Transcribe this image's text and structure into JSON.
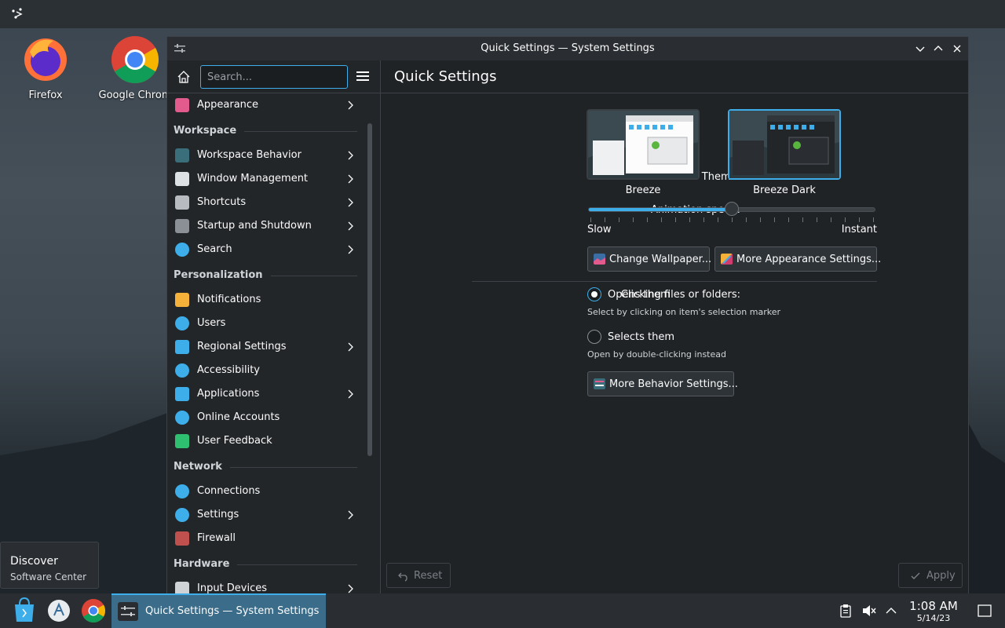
{
  "desktop": {
    "icons": [
      {
        "label": "Firefox",
        "icon": "firefox-icon"
      },
      {
        "label": "Google Chrom",
        "icon": "chrome-icon"
      }
    ]
  },
  "window": {
    "title": "Quick Settings — System Settings",
    "search_placeholder": "Search...",
    "sidebar": {
      "items": [
        {
          "label": "Appearance",
          "icon": "appearance-icon",
          "chevron": true
        },
        {
          "section": "Workspace"
        },
        {
          "label": "Workspace Behavior",
          "icon": "workspace-behavior-icon",
          "chevron": true
        },
        {
          "label": "Window Management",
          "icon": "window-management-icon",
          "chevron": true
        },
        {
          "label": "Shortcuts",
          "icon": "keyboard-icon",
          "chevron": true
        },
        {
          "label": "Startup and Shutdown",
          "icon": "startup-icon",
          "chevron": true
        },
        {
          "label": "Search",
          "icon": "search-icon",
          "chevron": true
        },
        {
          "section": "Personalization"
        },
        {
          "label": "Notifications",
          "icon": "bell-icon",
          "chevron": false
        },
        {
          "label": "Users",
          "icon": "users-icon",
          "chevron": false
        },
        {
          "label": "Regional Settings",
          "icon": "regional-icon",
          "chevron": true
        },
        {
          "label": "Accessibility",
          "icon": "accessibility-icon",
          "chevron": false
        },
        {
          "label": "Applications",
          "icon": "applications-icon",
          "chevron": true
        },
        {
          "label": "Online Accounts",
          "icon": "online-accounts-icon",
          "chevron": false
        },
        {
          "label": "User Feedback",
          "icon": "feedback-icon",
          "chevron": false
        },
        {
          "section": "Network"
        },
        {
          "label": "Connections",
          "icon": "globe-icon",
          "chevron": false
        },
        {
          "label": "Settings",
          "icon": "globe-icon",
          "chevron": true
        },
        {
          "label": "Firewall",
          "icon": "firewall-icon",
          "chevron": false
        },
        {
          "section": "Hardware"
        },
        {
          "label": "Input Devices",
          "icon": "mouse-icon",
          "chevron": true
        }
      ]
    },
    "main": {
      "heading": "Quick Settings",
      "theme_label": "Theme:",
      "themes": [
        {
          "name": "Breeze",
          "selected": false
        },
        {
          "name": "Breeze Dark",
          "selected": true
        }
      ],
      "animation_label": "Animation speed:",
      "animation_value": 0.5,
      "slow_label": "Slow",
      "instant_label": "Instant",
      "change_wallpaper": "Change Wallpaper...",
      "more_appearance": "More Appearance Settings...",
      "clicking_label": "Clicking files or folders:",
      "opens_them": "Opens them",
      "opens_hint": "Select by clicking on item's selection marker",
      "selects_them": "Selects them",
      "selects_hint": "Open by double-clicking instead",
      "more_behavior": "More Behavior Settings...",
      "reset": "Reset",
      "apply": "Apply"
    }
  },
  "tooltip": {
    "title": "Discover",
    "subtitle": "Software Center"
  },
  "taskbar": {
    "task_label": "Quick Settings  — System Settings",
    "time": "1:08 AM",
    "date": "5/14/23"
  },
  "colors": {
    "accent": "#3daee9",
    "window_bg": "#202326",
    "panel": "#2a2e32"
  }
}
